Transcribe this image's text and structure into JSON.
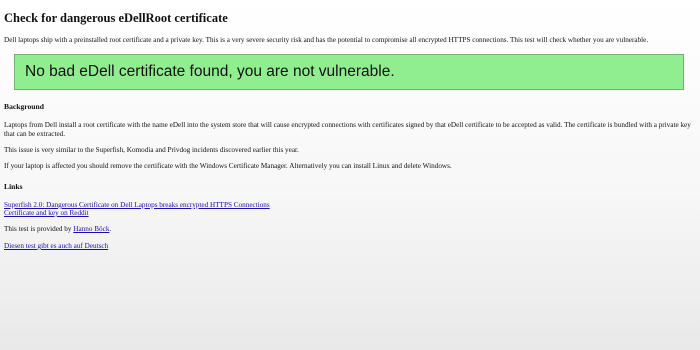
{
  "title": "Check for dangerous eDellRoot certificate",
  "intro": "Dell laptops ship with a preinstalled root certificate and a private key. This is a very severe security risk and has the potential to compromise all encrypted HTTPS connections. This test will check whether you are vulnerable.",
  "result": {
    "message": "No bad eDell certificate found, you are not vulnerable.",
    "color": "#90ee90"
  },
  "background": {
    "heading": "Background",
    "paragraph1": "Laptops from Dell install a root certificate with the name eDell into the system store that will cause encrypted connections with certificates signed by that eDell certificate to be accepted as valid. The certificate is bundled with a private key that can be extracted.",
    "paragraph2": "This issue is very similar to the Superfish, Komodia and Privdog incidents discovered earlier this year.",
    "paragraph3": "If your laptop is affected you should remove the certificate with the Windows Certificate Manager. Alternatively you can install Linux and delete Windows."
  },
  "links": {
    "heading": "Links",
    "items": [
      "Superfish 2.0: Dangerous Certificate on Dell Laptops breaks encrypted HTTPS Connections",
      "Certificate and key on Reddit"
    ]
  },
  "footer": {
    "provided_prefix": "This test is provided by ",
    "author": "Hanno Böck",
    "provided_suffix": ".",
    "german_link": "Diesen test gibt es auch auf Deutsch"
  }
}
